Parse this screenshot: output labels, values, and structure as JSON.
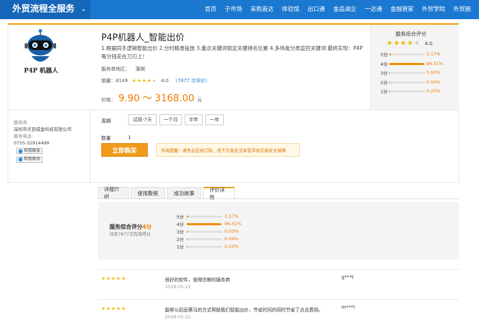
{
  "header": {
    "site_name": "外贸流程全服务",
    "chevron": "⌄",
    "nav": [
      "首页",
      "子市场",
      "采购直达",
      "体验馆",
      "出口通",
      "金品诚企",
      "一达通",
      "金融管家",
      "外贸学院",
      "外贸圈"
    ]
  },
  "product": {
    "logo_label": "P4P 机器人",
    "title": "P4P机器人_智能出价",
    "description": "1.根据同手逻辑智能出价 2.分时精准投放 3.重点关键词锁定关键排名位置 4.多纬度分类监控关键词 最终实现：P4P每分钱花在刀刃上！",
    "region_label": "服务商地区：",
    "region_value": "深圳",
    "sales_label": "销量：8149",
    "rating_value": "4.0",
    "review_count_link": "（7877 次评价）",
    "price_label": "价格：",
    "price_low": "9.90",
    "price_sep": "～",
    "price_high": "3168.00",
    "price_unit": "元"
  },
  "rating_panel": {
    "title": "服务综合评分",
    "overall": "4.0",
    "stars_filled": 4,
    "rows": [
      {
        "label": "5分",
        "percent": 3.17,
        "text": "3.17%"
      },
      {
        "label": "4分",
        "percent": 96.51,
        "text": "96.51%"
      },
      {
        "label": "3分",
        "percent": 0.03,
        "text": "0.03%"
      },
      {
        "label": "2分",
        "percent": 0.04,
        "text": "0.04%"
      },
      {
        "label": "1分",
        "percent": 0.25,
        "text": "0.25%"
      }
    ]
  },
  "seller": {
    "provider_label": "服务商:",
    "provider_name": "深圳市点百成金科技有限公司",
    "phone_label": "服务电话:",
    "phone": "0755-32914499",
    "contact_label": "和我联系"
  },
  "purchase": {
    "period_label": "周期",
    "periods": [
      "试用-7天",
      "一个月",
      "半年",
      "一年"
    ],
    "qty_label": "数量",
    "qty_value": "1",
    "buy_label": "立即购买",
    "tip": "市场提醒：请务必在线订购，线下交易无法享受市场交易安全保障"
  },
  "tabs": [
    "详细介绍",
    "使用教程",
    "成功故事",
    "评价详情"
  ],
  "summary": {
    "title_prefix": "服务综合评分",
    "score": "4分",
    "subtitle": "共有7877次有效得分"
  },
  "reviews": [
    {
      "stars": "★★★★★",
      "text": "很好的软件，值得信赖的服务商",
      "date": "2018-05-22",
      "user": "g***t"
    },
    {
      "stars": "★★★★★",
      "text": "能够以田忌赛马的方式帮助我们智能出价，节省时间的同时节省了点击费用。",
      "date": "2018-05-22",
      "user": "m***l"
    }
  ]
}
